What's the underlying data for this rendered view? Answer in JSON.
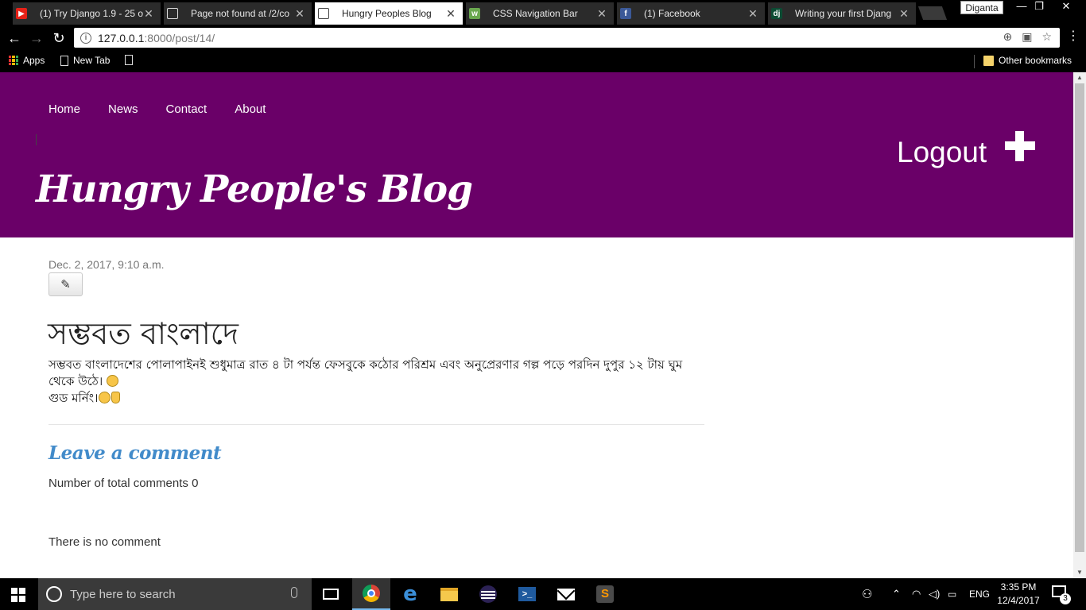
{
  "browser": {
    "tabs": [
      {
        "title": "(1) Try Django 1.9 - 25 o",
        "favicon": "youtube-icon",
        "active": false
      },
      {
        "title": "Page not found at /2/co",
        "favicon": "page-icon",
        "active": false
      },
      {
        "title": "Hungry Peoples Blog",
        "favicon": "page-icon",
        "active": true
      },
      {
        "title": "CSS Navigation Bar",
        "favicon": "w3schools-icon",
        "active": false
      },
      {
        "title": "(1) Facebook",
        "favicon": "facebook-icon",
        "active": false
      },
      {
        "title": "Writing your first Djang",
        "favicon": "django-icon",
        "active": false
      }
    ],
    "profile_name": "Diganta",
    "url_host": "127.0.0.1",
    "url_path": ":8000/post/14/",
    "bookmarks": {
      "apps": "Apps",
      "new_tab": "New Tab",
      "other": "Other bookmarks"
    }
  },
  "site": {
    "nav": [
      "Home",
      "News",
      "Contact",
      "About"
    ],
    "logout": "Logout",
    "title": "Hungry People's Blog",
    "header_color": "#6a0068"
  },
  "post": {
    "date": "Dec. 2, 2017, 9:10 a.m.",
    "title": "সম্ভবত বাংলাদে",
    "body_line1": "সম্ভবত বাংলাদেশের পোলাপাইনই শুধুমাত্র রাত ৪ টা পর্যন্ত ফেসবুকে কঠোর পরিশ্রম এবং অনুপ্রেরণার গল্প পড়ে পরদিন দুপুর ১২ টায় ঘুম থেকে উঠে।",
    "body_line2": "গুড মর্নিং।"
  },
  "comments": {
    "heading": "Leave a comment",
    "total_label": "Number of total comments 0",
    "empty_text": "There is no comment",
    "heading_color": "#428bca"
  },
  "taskbar": {
    "search_placeholder": "Type here to search",
    "language": "ENG",
    "time": "3:35 PM",
    "date": "12/4/2017",
    "notification_count": "3"
  }
}
